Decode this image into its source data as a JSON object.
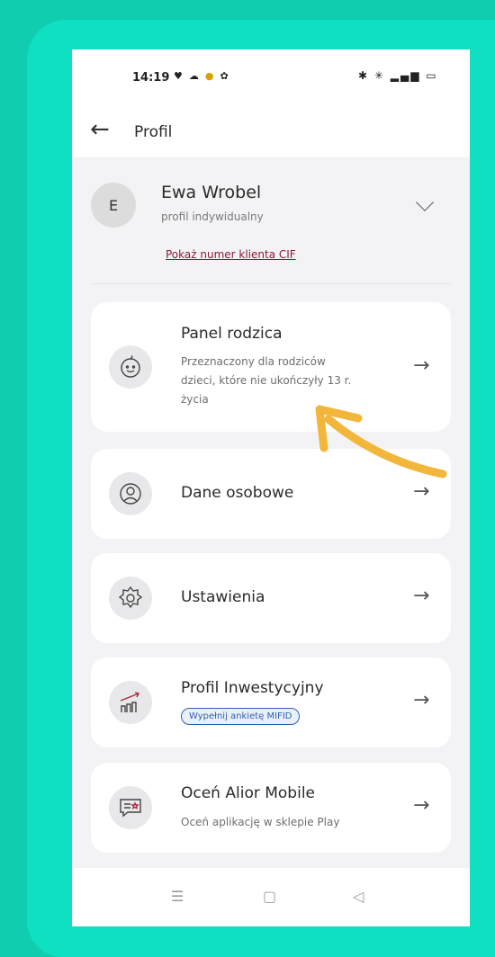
{
  "status": {
    "time": "14:19"
  },
  "header": {
    "title": "Profil"
  },
  "profile": {
    "initial": "E",
    "name": "Ewa Wrobel",
    "type": "profil indywidualny",
    "cif_link": "Pokaż numer klienta CIF"
  },
  "cards": [
    {
      "title": "Panel rodzica",
      "subtitle": [
        "Przeznaczony dla rodziców",
        "dzieci, które nie ukończyły 13 r.",
        "życia"
      ]
    },
    {
      "title": "Dane osobowe"
    },
    {
      "title": "Ustawienia"
    },
    {
      "title": "Profil Inwestycyjny",
      "badge": "Wypełnij ankietę MIFID"
    },
    {
      "title": "Oceń Alior Mobile",
      "subtitle": [
        "Oceń aplikację w sklepie Play"
      ]
    }
  ],
  "colors": {
    "background": "#10cdb0",
    "frame": "#0fe0c2",
    "annotation_arrow": "#f2b63a",
    "cif_link": "#8a1a36",
    "badge": "#2d5fb0"
  }
}
